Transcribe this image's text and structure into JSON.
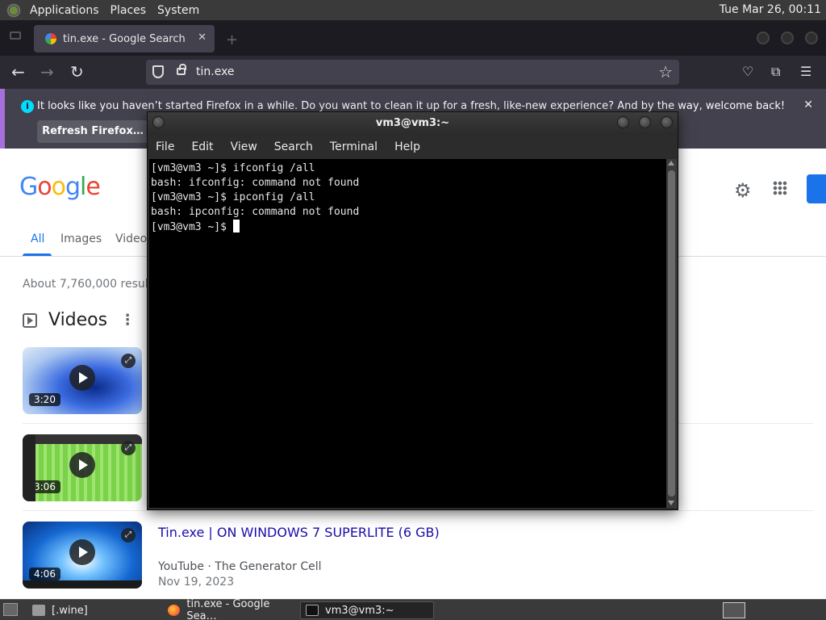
{
  "top_panel": {
    "menus": [
      "Applications",
      "Places",
      "System"
    ],
    "clock": "Tue Mar 26, 00:11"
  },
  "browser": {
    "tab_title": "tin.exe - Google Search",
    "tab_close": "✕",
    "url": "tin.exe",
    "notice_text": "It looks like you haven’t started Firefox in a while. Do you want to clean it up for a fresh, like-new experience? And by the way, welcome back!",
    "notice_button": "Refresh Firefox…",
    "notice_close": "✕"
  },
  "google": {
    "logo": "Google",
    "tabs": [
      "All",
      "Images",
      "Videos"
    ],
    "stats": "About 7,760,000 results",
    "videos_header": "Videos",
    "videos": [
      {
        "duration": "3:20"
      },
      {
        "duration": "3:06"
      },
      {
        "duration": "4:06"
      }
    ],
    "result3": {
      "title": "Tin.exe | ON WINDOWS 7 SUPERLITE (6 GB)",
      "source": "YouTube · The Generator Cell",
      "date": "Nov 19, 2023"
    }
  },
  "terminal": {
    "title": "vm3@vm3:~",
    "menu": [
      "File",
      "Edit",
      "View",
      "Search",
      "Terminal",
      "Help"
    ],
    "lines": [
      "[vm3@vm3 ~]$ ifconfig /all",
      "bash: ifconfig: command not found",
      "[vm3@vm3 ~]$ ipconfig /all",
      "bash: ipconfig: command not found",
      "[vm3@vm3 ~]$ "
    ]
  },
  "taskbar": {
    "items": [
      "[.wine]",
      "tin.exe - Google Sea…",
      "vm3@vm3:~"
    ]
  },
  "colors": {
    "accent": "#1a73e8",
    "link": "#1a0dab",
    "notice_bar": "#a76fdc"
  }
}
